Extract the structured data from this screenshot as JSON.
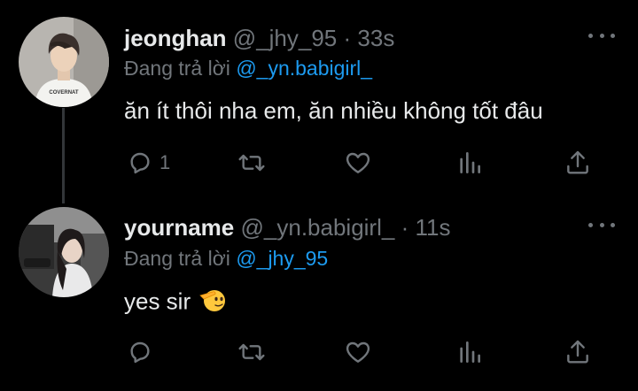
{
  "tweets": [
    {
      "display_name": "jeonghan",
      "handle": "@_jhy_95",
      "separator": "·",
      "time": "33s",
      "reply_prefix": "Đang trả lời",
      "reply_to": "@_yn.babigirl_",
      "text": "ăn ít thôi nha em, ăn nhiều không tốt đâu",
      "reply_count": "1",
      "avatar_shirt_text": "COVERNAT"
    },
    {
      "display_name": "yourname",
      "handle": "@_yn.babigirl_",
      "separator": "·",
      "time": "11s",
      "reply_prefix": "Đang trả lời",
      "reply_to": "@_jhy_95",
      "text": "yes sir",
      "emoji": "saluting-face",
      "reply_count": ""
    }
  ],
  "colors": {
    "background": "#000000",
    "text": "#e7e9ea",
    "secondary": "#71767b",
    "link": "#1d9bf0",
    "thread_line": "#333639"
  },
  "icons": [
    "reply-icon",
    "retweet-icon",
    "like-icon",
    "views-icon",
    "share-icon",
    "more-icon"
  ]
}
